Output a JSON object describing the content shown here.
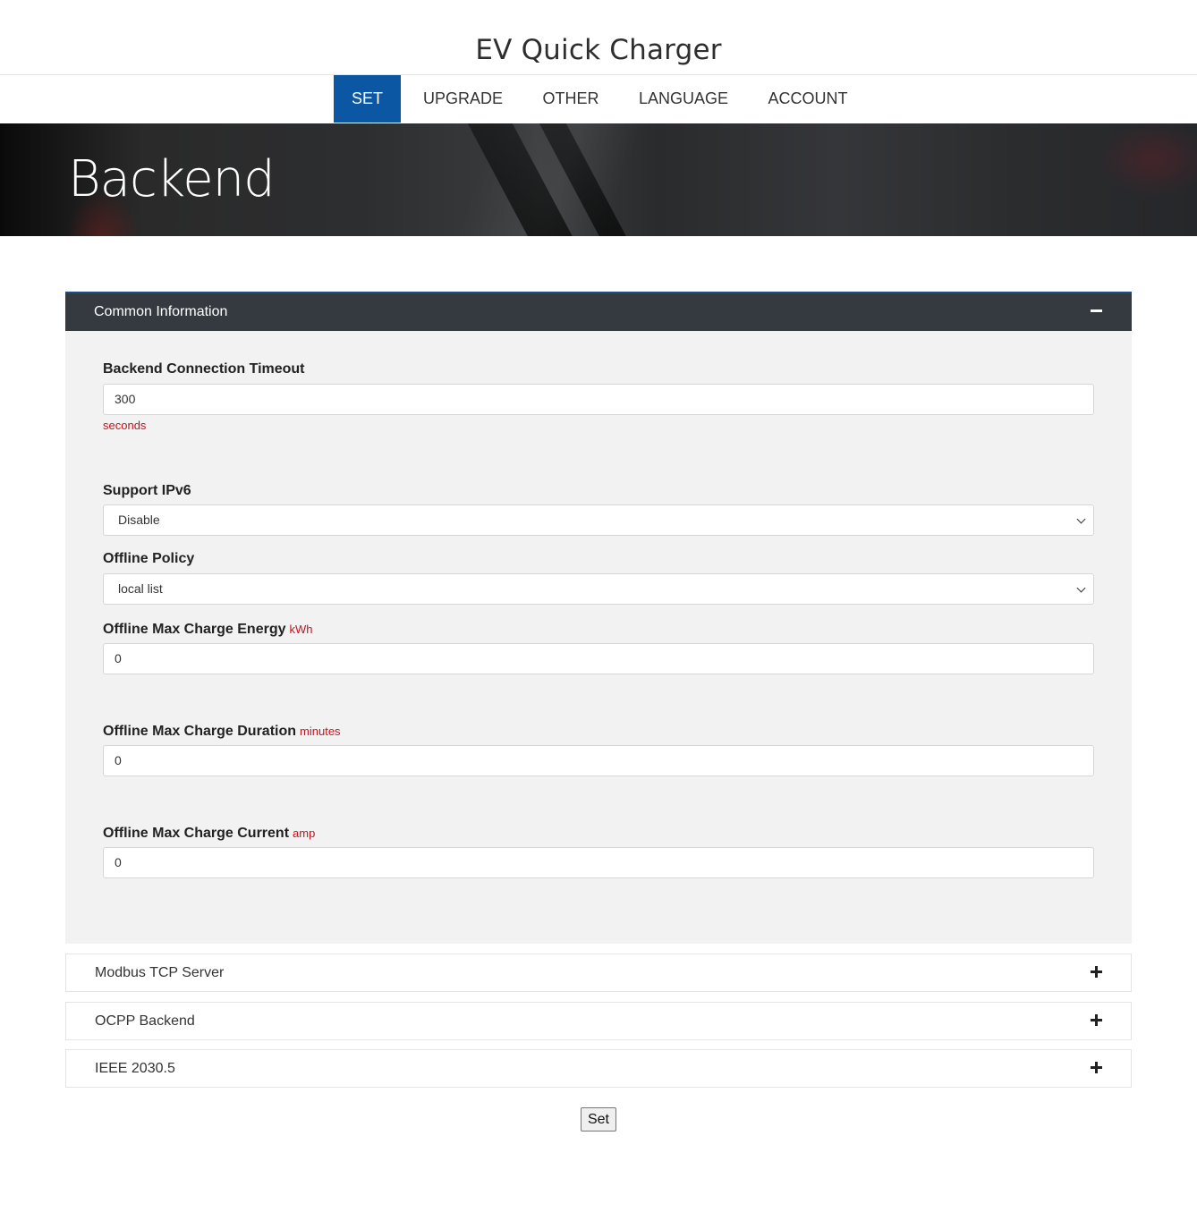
{
  "app": {
    "title": "EV Quick Charger"
  },
  "nav": {
    "items": [
      {
        "label": "SET",
        "active": true
      },
      {
        "label": "UPGRADE"
      },
      {
        "label": "OTHER"
      },
      {
        "label": "LANGUAGE"
      },
      {
        "label": "ACCOUNT"
      }
    ]
  },
  "hero": {
    "title": "Backend"
  },
  "common": {
    "title": "Common Information",
    "timeout": {
      "label": "Backend Connection Timeout",
      "value": "300",
      "hint": "seconds"
    },
    "ipv6": {
      "label": "Support IPv6",
      "selected": "Disable"
    },
    "offline_policy": {
      "label": "Offline Policy",
      "selected": "local list"
    },
    "max_energy": {
      "label": "Offline Max Charge Energy",
      "unit": "kWh",
      "value": "0"
    },
    "max_duration": {
      "label": "Offline Max Charge Duration",
      "unit": "minutes",
      "value": "0"
    },
    "max_current": {
      "label": "Offline Max Charge Current",
      "unit": "amp",
      "value": "0"
    }
  },
  "sections": [
    {
      "title": "Modbus TCP Server"
    },
    {
      "title": "OCPP Backend"
    },
    {
      "title": "IEEE 2030.5"
    }
  ],
  "actions": {
    "set_label": "Set"
  },
  "colors": {
    "nav_active": "#0b57a4",
    "panel_header": "#343a40",
    "unit_red": "#c0151e"
  }
}
